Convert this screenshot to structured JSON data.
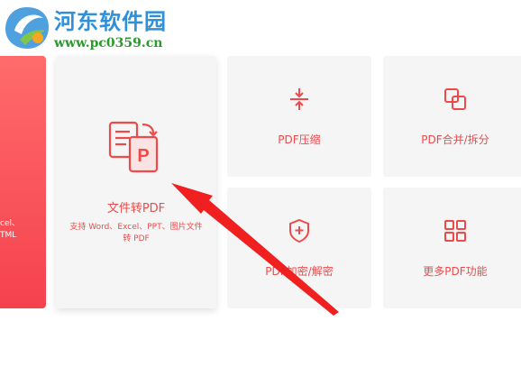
{
  "watermark": {
    "title": "河东软件园",
    "url": "www.pc0359.cn"
  },
  "left_card": {
    "text_line1": "cel、",
    "text_line2": "TML"
  },
  "cards": {
    "main": {
      "label": "文件转PDF",
      "desc": "支持 Word、Excel、PPT、图片文件转 PDF",
      "icon": "file-to-pdf-icon"
    },
    "compress": {
      "label": "PDF压缩",
      "icon": "compress-icon"
    },
    "merge": {
      "label": "PDF合并/拆分",
      "icon": "merge-split-icon"
    },
    "encrypt": {
      "label": "PDF加密/解密",
      "icon": "shield-plus-icon"
    },
    "more": {
      "label": "更多PDF功能",
      "icon": "grid-icon"
    }
  },
  "colors": {
    "accent": "#ef4a4a",
    "card_bg": "#f5f5f5",
    "annotation_arrow": "#f02020",
    "watermark_blue": "#2f8fd8",
    "watermark_green": "#2a9a2a"
  }
}
